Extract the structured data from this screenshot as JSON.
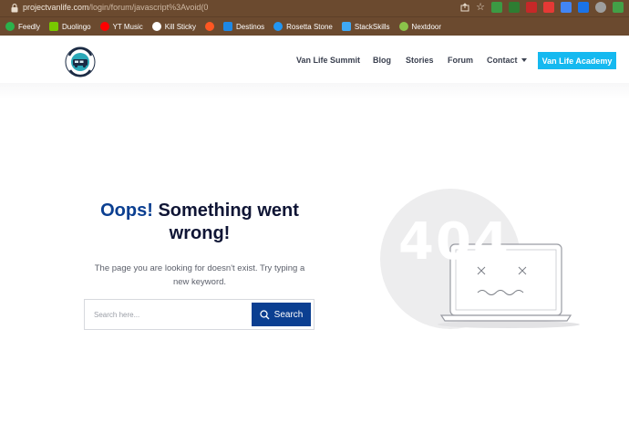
{
  "browser": {
    "url_host": "projectvanlife.com",
    "url_path": "/login/forum/javascript%3Avoid(0",
    "bookmarks": [
      {
        "label": "Feedly",
        "color": "#2bb24c"
      },
      {
        "label": "Duolingo",
        "color": "#78c800"
      },
      {
        "label": "YT Music",
        "color": "#ff0000"
      },
      {
        "label": "Kill Sticky",
        "color": "#ffffff"
      },
      {
        "label": "",
        "color": "#ff5722"
      },
      {
        "label": "Destinos",
        "color": "#1e88e5"
      },
      {
        "label": "Rosetta Stone",
        "color": "#2196f3"
      },
      {
        "label": "StackSkills",
        "color": "#3fa9f5"
      },
      {
        "label": "Nextdoor",
        "color": "#8bc34a"
      }
    ]
  },
  "site": {
    "logo_alt": "Project Van Life",
    "nav": {
      "summit": "Van Life Summit",
      "blog": "Blog",
      "stories": "Stories",
      "forum": "Forum",
      "contact": "Contact",
      "academy": "Van Life Academy"
    }
  },
  "error": {
    "title_accent": "Oops!",
    "title_rest": "Something went wrong!",
    "description": "The page you are looking for doesn't exist. Try typing a new keyword.",
    "search_placeholder": "Search here...",
    "search_button": "Search",
    "code": "404"
  },
  "colors": {
    "chrome_bg": "#6b4a2f",
    "brand_blue": "#0b3f91",
    "cta": "#15b9f0"
  }
}
